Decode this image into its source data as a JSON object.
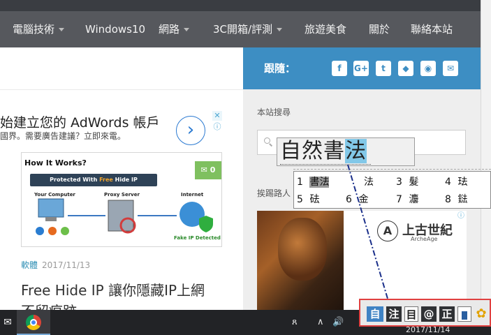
{
  "nav": {
    "items": [
      {
        "label": "電腦技術",
        "dropdown": true
      },
      {
        "label": "Windows10",
        "dropdown": false
      },
      {
        "label": "網路",
        "dropdown": true
      },
      {
        "label": "3C開箱/評測",
        "dropdown": true
      },
      {
        "label": "旅遊美食",
        "dropdown": false
      },
      {
        "label": "關於",
        "dropdown": false
      },
      {
        "label": "聯絡本站",
        "dropdown": false
      }
    ]
  },
  "ad": {
    "title": "始建立您的 AdWords 帳戶",
    "subtitle": "國界。需要廣告建議？立即來電。",
    "close": "✕",
    "info": "ⓘ",
    "arrow": "›"
  },
  "post": {
    "thumb_title": "How It Works?",
    "thumb_banner_prefix": "Protected With ",
    "thumb_banner_highlight": "Free",
    "thumb_banner_suffix": " Hide IP",
    "thumb_labels": [
      "Your Computer",
      "Proxy Server",
      "Internet",
      "Fake IP Detected"
    ],
    "comment_count": "0",
    "category": "軟體",
    "date": "2017/11/13",
    "title_line1": "Free Hide IP 讓你隱藏IP上網",
    "title_line2": "不留痕跡"
  },
  "sidebar": {
    "follow_label": "跟隨：",
    "social_icons": [
      "facebook-icon",
      "google-plus-icon",
      "twitter-icon",
      "android-icon",
      "rss-icon",
      "mail-icon"
    ],
    "social_glyphs": [
      "f",
      "G+",
      "t",
      "◆",
      "◉",
      "✉"
    ],
    "search_label": "本站搜尋",
    "side_text": "挨踢路人",
    "ad2_brand": "上古世紀",
    "ad2_brand_sub": "ArcheAge",
    "ad2_logo": "A"
  },
  "ime": {
    "composition_plain": "自然書",
    "composition_selected": "法",
    "candidates": [
      {
        "num": "1",
        "text": "書法",
        "selected": true
      },
      {
        "num": "2",
        "text": "法",
        "selected": false
      },
      {
        "num": "3",
        "text": "髮",
        "selected": false
      },
      {
        "num": "4",
        "text": "珐",
        "selected": false
      },
      {
        "num": "5",
        "text": "砝",
        "selected": false
      },
      {
        "num": "6",
        "text": "金",
        "selected": false
      },
      {
        "num": "7",
        "text": "灋",
        "selected": false
      },
      {
        "num": "8",
        "text": "鍅",
        "selected": false
      }
    ],
    "toolbar": {
      "mode": "自",
      "input": "注",
      "menu": "目",
      "symbol": "@",
      "width": "正"
    }
  },
  "taskbar": {
    "clock_date": "2017/11/14",
    "tray_people": "ጸ",
    "tray_up": "∧",
    "tray_volume": "🔊"
  },
  "colors": {
    "nav_bg": "#56585d",
    "follow_bar": "#3d8ec3",
    "ime_blue": "#3f83c4",
    "ime_toolbar_border": "#e04040"
  }
}
